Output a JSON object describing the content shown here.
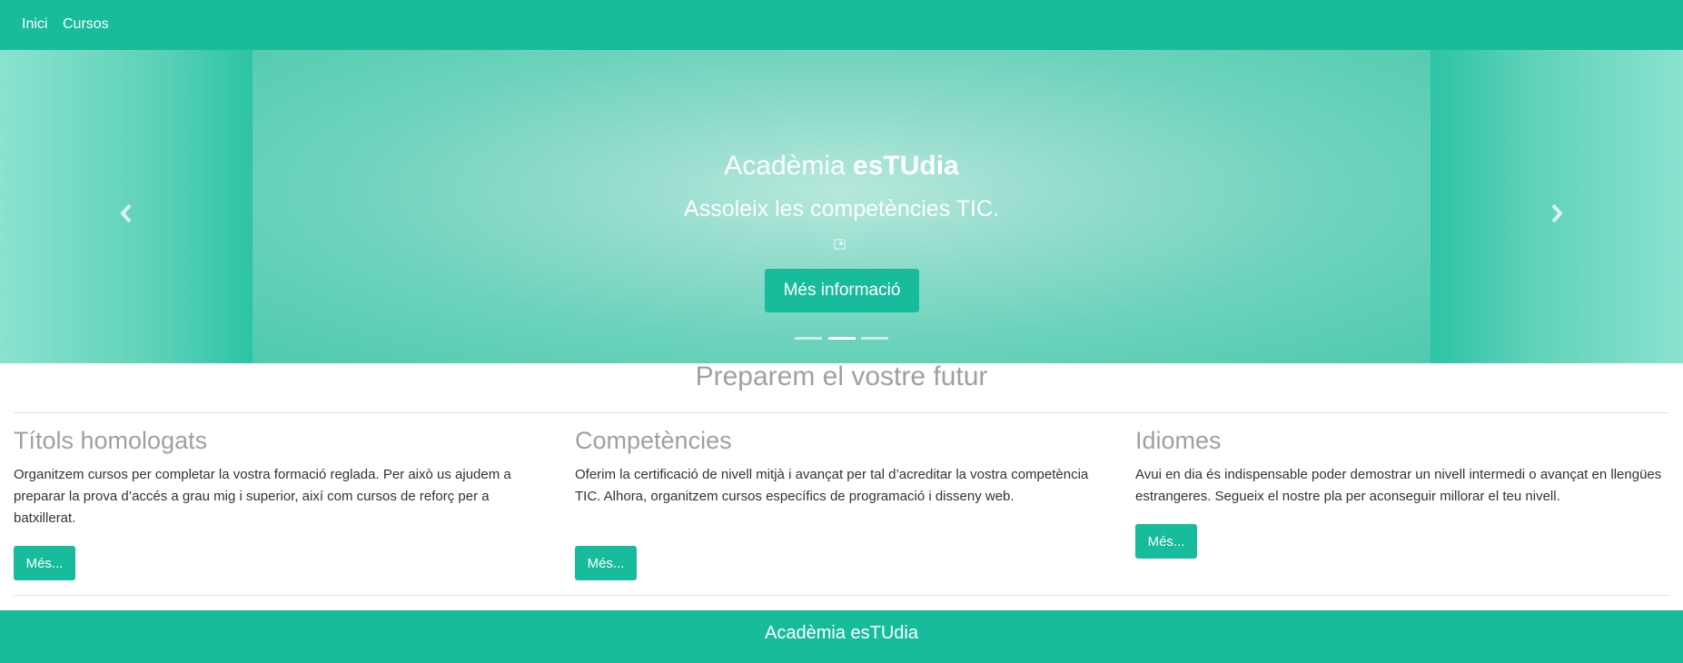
{
  "nav": {
    "items": [
      "Inici",
      "Cursos"
    ]
  },
  "carousel": {
    "title_prefix": "Acadèmia ",
    "title_brand": "esTUdia",
    "subtitle": "Assoleix les competències TIC.",
    "button_label": "Més informació",
    "active_indicator": 2,
    "indicator_count": 3,
    "prev_icon": "chevron-left-icon",
    "next_icon": "chevron-right-icon"
  },
  "section": {
    "title": "Preparem el vostre futur"
  },
  "features": [
    {
      "title": "Títols homologats",
      "text": "Organitzem cursos per completar la vostra formació reglada. Per això us ajudem a preparar la prova d’accés a grau mig i superior, així com cursos de reforç per a batxillerat.",
      "button": "Més..."
    },
    {
      "title": "Competències",
      "text": "Oferim la certificació de nivell mitjà i avançat per tal d’acreditar la vostra competència TIC. Alhora, organitzem cursos específics de programació i disseny web.",
      "button": "Més..."
    },
    {
      "title": "Idiomes",
      "text": "Avui en dia és indispensable poder demostrar un nivell intermedi o avançat en llengües estrangeres. Segueix el nostre pla per aconseguir millorar el teu nivell.",
      "button": "Més..."
    }
  ],
  "footer": {
    "text": "Acadèmia esTUdia"
  },
  "colors": {
    "primary": "#18bc9c",
    "heading_gray": "#a0a0a0"
  }
}
